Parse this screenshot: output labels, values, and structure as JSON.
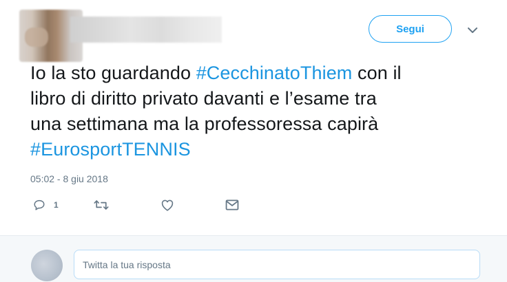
{
  "follow_button": {
    "label": "Segui",
    "color": "#1da1f2"
  },
  "menu": {
    "icon": "chevron-down-icon"
  },
  "tweet": {
    "text_lines": [
      [
        {
          "text": "Io la sto guardando "
        },
        {
          "text": "#CecchinatoThiem",
          "hashtag": true
        },
        {
          "text": " con il"
        }
      ],
      [
        {
          "text": "libro di diritto privato davanti e l’esame tra"
        }
      ],
      [
        {
          "text": "una settimana ma la professoressa capirà"
        }
      ],
      [
        {
          "text": "#EurosportTENNIS",
          "hashtag": true
        }
      ]
    ],
    "hashtag_color": "#1b95e0",
    "timestamp": "05:02 - 8 giu 2018"
  },
  "actions": {
    "reply": {
      "icon": "reply-icon",
      "count": "1"
    },
    "retweet": {
      "icon": "retweet-icon"
    },
    "like": {
      "icon": "heart-icon"
    },
    "message": {
      "icon": "envelope-icon"
    }
  },
  "reply_box": {
    "placeholder": "Twitta la tua risposta"
  }
}
